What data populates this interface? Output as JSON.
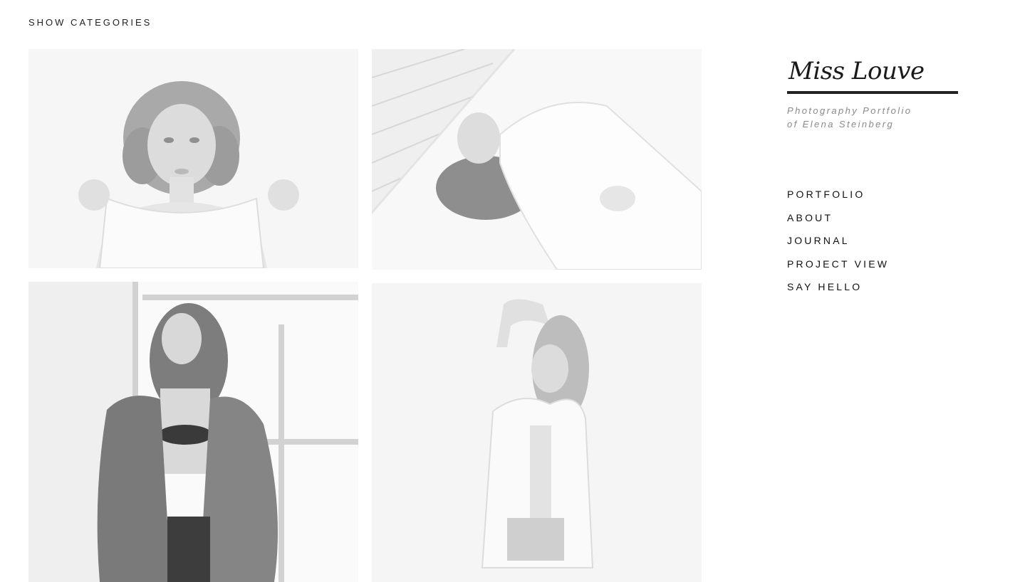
{
  "header": {
    "show_categories": "SHOW CATEGORIES"
  },
  "brand": {
    "logo": "Miss Louve",
    "tagline_line1": "Photography Portfolio",
    "tagline_line2": "of Elena Steinberg"
  },
  "nav": {
    "items": [
      {
        "label": "PORTFOLIO"
      },
      {
        "label": "ABOUT"
      },
      {
        "label": "JOURNAL"
      },
      {
        "label": "PROJECT VIEW"
      },
      {
        "label": "SAY HELLO"
      }
    ]
  },
  "gallery": {
    "photos": [
      {
        "subject": "curly-haired woman holding white top"
      },
      {
        "subject": "woman lying on white bed"
      },
      {
        "subject": "woman in fur coat by window"
      },
      {
        "subject": "woman in white shirt with arm raised"
      }
    ]
  },
  "colors": {
    "text": "#222222",
    "tagline": "#8a8a8a",
    "rule": "#222222",
    "background": "#ffffff"
  }
}
